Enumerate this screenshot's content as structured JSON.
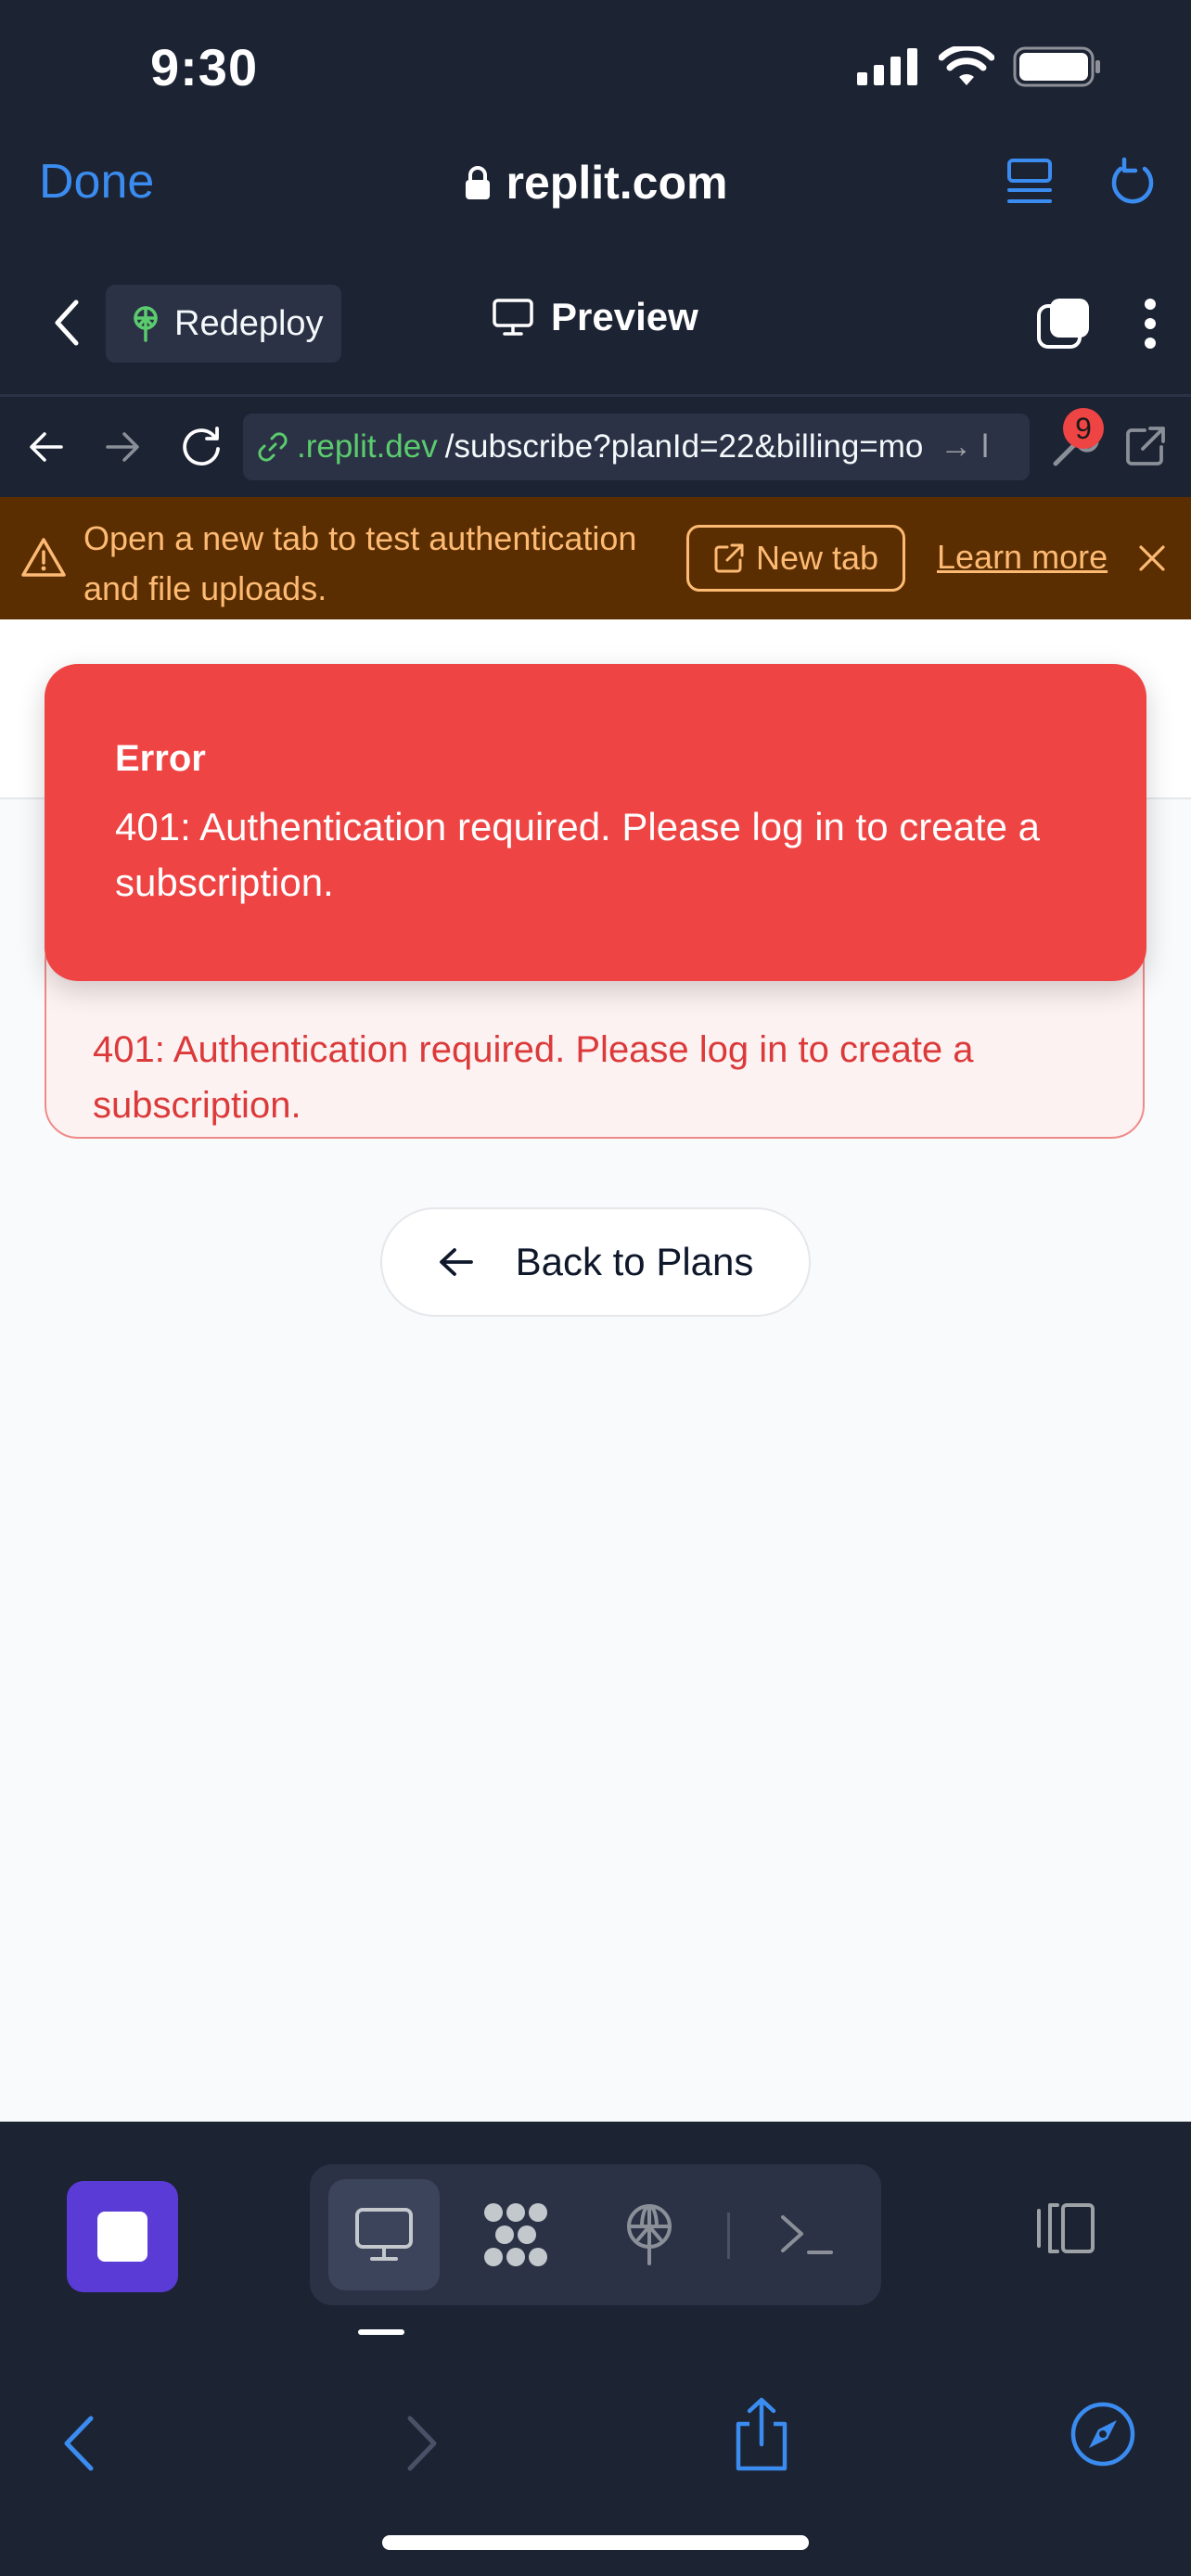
{
  "status_bar": {
    "time": "9:30"
  },
  "safari": {
    "done_label": "Done",
    "domain": "replit.com"
  },
  "replit_header": {
    "redeploy_label": "Redeploy",
    "preview_label": "Preview"
  },
  "nav": {
    "url_host": ".replit.dev",
    "url_path": "/subscribe?planId=22&billing=mo",
    "url_suffix": "→ l",
    "badge_count": "9"
  },
  "banner": {
    "message": "Open a new tab to test authentication and file uploads.",
    "new_tab_label": "New tab",
    "learn_more_label": "Learn more"
  },
  "toast": {
    "title": "Error",
    "message": "401: Authentication required. Please log in to create a subscription."
  },
  "inline_error": {
    "message": "401: Authentication required. Please log in to create a subscription."
  },
  "actions": {
    "back_to_plans_label": "Back to Plans"
  },
  "colors": {
    "chrome_bg": "#1c2333",
    "accent_blue": "#3b8cf0",
    "url_host_green": "#5bcc6e",
    "banner_bg": "#5a2e00",
    "banner_text": "#fdba74",
    "toast_bg": "#ef4444",
    "inline_error_text": "#dc3a3a",
    "stop_purple": "#5b3bd6"
  }
}
